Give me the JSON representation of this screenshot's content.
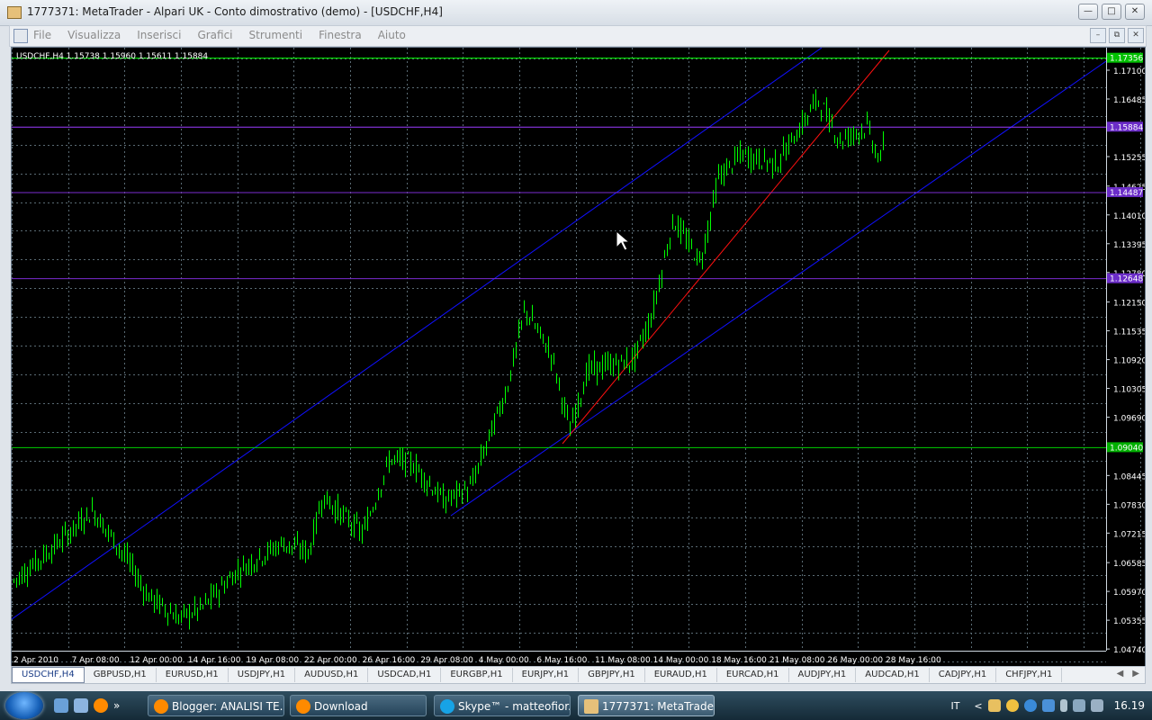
{
  "window": {
    "title": "1777371: MetaTrader - Alpari UK - Conto dimostrativo (demo) - [USDCHF,H4]",
    "controls": [
      "—",
      "□",
      "✕"
    ]
  },
  "menu": {
    "items": [
      "File",
      "Visualizza",
      "Inserisci",
      "Grafici",
      "Strumenti",
      "Finestra",
      "Aiuto"
    ],
    "mdi_controls": [
      "–",
      "⧉",
      "✕"
    ]
  },
  "chart": {
    "header": "USDCHF,H4  1.15738 1.15960 1.15611 1.15884",
    "price_labels": [
      "1.17100",
      "1.16485",
      "1.15255",
      "1.14625",
      "1.14010",
      "1.13395",
      "1.12780",
      "1.12150",
      "1.11535",
      "1.10920",
      "1.10305",
      "1.09690",
      "1.08445",
      "1.07830",
      "1.07215",
      "1.06585",
      "1.05970",
      "1.05355",
      "1.04740"
    ],
    "date_labels": [
      "2 Apr 2010",
      "7 Apr 08:00",
      "12 Apr 00:00",
      "14 Apr 16:00",
      "19 Apr 08:00",
      "22 Apr 00:00",
      "26 Apr 16:00",
      "29 Apr 08:00",
      "4 May 00:00",
      "6 May 16:00",
      "11 May 08:00",
      "14 May 00:00",
      "18 May 16:00",
      "21 May 08:00",
      "26 May 00:00",
      "28 May 16:00"
    ],
    "hlines": [
      {
        "price": "1.17356",
        "color": "#00ff00",
        "box": "#00c000"
      },
      {
        "price": "1.15884",
        "color": "#9c3cff",
        "box": "#6b2cc8"
      },
      {
        "price": "1.14487",
        "color": "#7a2cd0",
        "box": "#6b2cc8"
      },
      {
        "price": "1.12648",
        "color": "#7a2cd0",
        "box": "#6b2cc8"
      },
      {
        "price": "1.09040",
        "color": "#00d000",
        "box": "#00b000"
      }
    ],
    "colors": {
      "candle": "#00ff00",
      "grid": "#5a6b74",
      "channel": "#1010ff",
      "trend": "#ff1010",
      "axis_text": "#ffffff"
    }
  },
  "symbol_tabs": [
    "USDCHF,H4",
    "GBPUSD,H1",
    "EURUSD,H1",
    "USDJPY,H1",
    "AUDUSD,H1",
    "USDCAD,H1",
    "EURGBP,H1",
    "EURJPY,H1",
    "GBPJPY,H1",
    "EURAUD,H1",
    "EURCAD,H1",
    "AUDJPY,H1",
    "AUDCAD,H1",
    "CADJPY,H1",
    "CHFJPY,H1"
  ],
  "tab_arrows": [
    "◀",
    "▶"
  ],
  "taskbar": {
    "quick_launch_more": "»",
    "tasks": [
      {
        "label": "Blogger: ANALISI TE...",
        "color": "#ff8a00"
      },
      {
        "label": "Download",
        "color": "#ff8a00"
      },
      {
        "label": "Skype™ - matteofior...",
        "color": "#17a3e6"
      },
      {
        "label": "1777371: MetaTrade...",
        "color": "#e6c07a"
      }
    ],
    "lang": "IT",
    "tray_left": "<",
    "clock": "16.19"
  }
}
